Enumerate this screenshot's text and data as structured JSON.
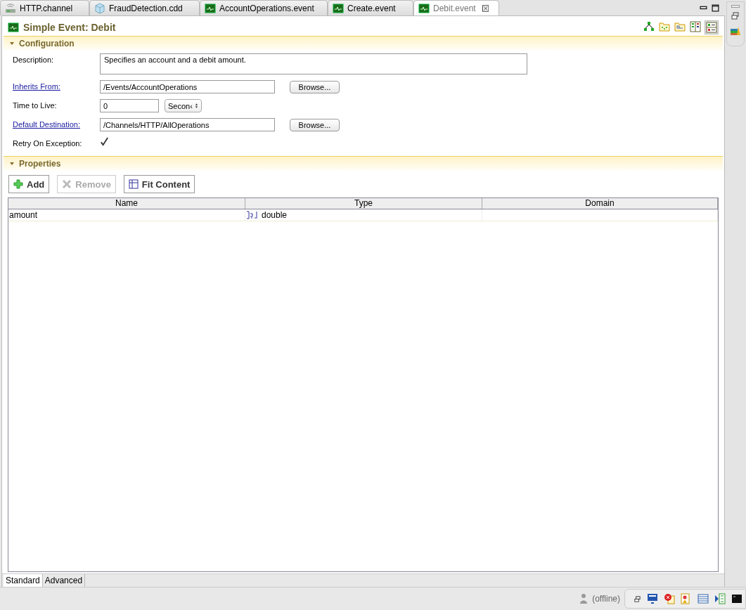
{
  "tabs": [
    {
      "label": "HTTP.channel",
      "kind": "channel",
      "selected": false
    },
    {
      "label": "FraudDetection.cdd",
      "kind": "cdd",
      "selected": false
    },
    {
      "label": "AccountOperations.event",
      "kind": "event",
      "selected": false
    },
    {
      "label": "Create.event",
      "kind": "event",
      "selected": false
    },
    {
      "label": "Debit.event",
      "kind": "event",
      "selected": true
    }
  ],
  "editor": {
    "title": "Simple Event: Debit"
  },
  "configuration": {
    "title": "Configuration",
    "expanded": true,
    "description": {
      "label": "Description:",
      "value": "Specifies an account and a debit amount."
    },
    "inherits_from": {
      "label": "Inherits From:",
      "value": "/Events/AccountOperations",
      "button": "Browse..."
    },
    "time_to_live": {
      "label": "Time to Live:",
      "value": "0",
      "unit": "Secon‹"
    },
    "default_destination": {
      "label": "Default Destination:",
      "value": "/Channels/HTTP/AllOperations",
      "button": "Browse..."
    },
    "retry_on_exception": {
      "label": "Retry On Exception:",
      "checked": true
    }
  },
  "properties": {
    "title": "Properties",
    "expanded": true,
    "buttons": [
      {
        "label": "Add",
        "kind": "add",
        "disabled": false
      },
      {
        "label": "Remove",
        "kind": "remove",
        "disabled": true
      },
      {
        "label": "Fit Content",
        "kind": "fit",
        "disabled": false
      }
    ],
    "table": {
      "columns": [
        "Name",
        "Type",
        "Domain"
      ],
      "rows": [
        {
          "name": "amount",
          "type": "double",
          "domain": ""
        }
      ]
    }
  },
  "bottom_tabs": [
    {
      "label": "Standard",
      "selected": true
    },
    {
      "label": "Advanced",
      "selected": false
    }
  ],
  "status_bar": {
    "user_status": "(offline)"
  }
}
